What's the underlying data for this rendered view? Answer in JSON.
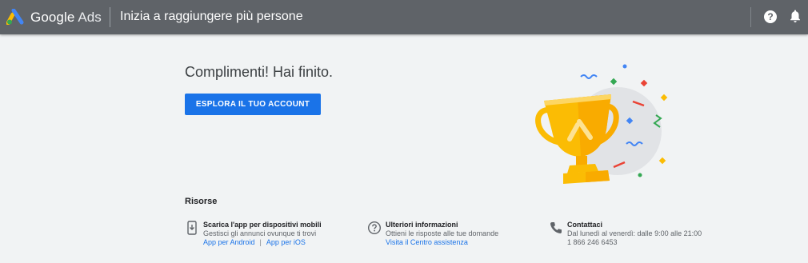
{
  "header": {
    "brand_google": "Google",
    "brand_product": "Ads",
    "page_title": "Inizia a raggiungere più persone",
    "help_label": "?"
  },
  "main": {
    "heading": "Complimenti! Hai finito.",
    "cta_label": "ESPLORA IL TUO ACCOUNT"
  },
  "resources": {
    "title": "Risorse",
    "mobile": {
      "title": "Scarica l'app per dispositivi mobili",
      "subtitle": "Gestisci gli annunci ovunque ti trovi",
      "link_android": "App per Android",
      "separator": "|",
      "link_ios": "App per iOS"
    },
    "info": {
      "title": "Ulteriori informazioni",
      "subtitle": "Ottieni le risposte alle tue domande",
      "link": "Visita il Centro assistenza"
    },
    "contact": {
      "title": "Contattaci",
      "hours": "Dal lunedì al venerdì: dalle 9:00 alle 21:00",
      "phone": "1 866 246 6453"
    }
  },
  "colors": {
    "topbar": "#5f6368",
    "accent": "#1a73e8",
    "background": "#f1f3f4",
    "trophy_gold": "#fbbc04"
  }
}
